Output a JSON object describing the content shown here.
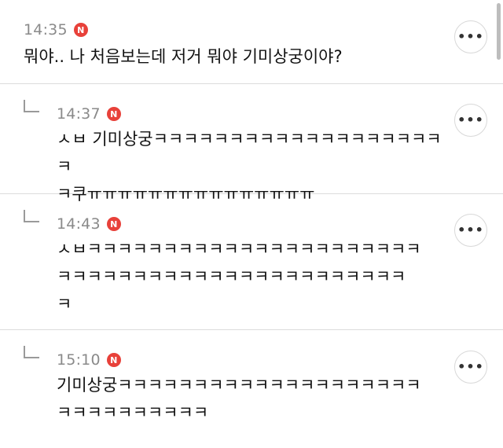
{
  "comments": [
    {
      "time": "14:35",
      "badge": "N",
      "text": "뭐야.. 나 처음보는데 저거 뭐야 기미상궁이야?",
      "more_label": "•••",
      "is_reply": false
    },
    {
      "time": "14:37",
      "badge": "N",
      "text": "ㅅㅂ 기미상궁ㅋㅋㅋㅋㅋㅋㅋㅋㅋㅋㅋㅋㅋㅋㅋㅋㅋㅋㅋㅋ\nㅋ쿠ㅠㅠㅠㅠㅠㅠㅠㅠㅠㅠㅠㅠㅠㅠㅠ",
      "more_label": "•••",
      "is_reply": true
    },
    {
      "time": "14:43",
      "badge": "N",
      "text": "ㅅㅂㅋㅋㅋㅋㅋㅋㅋㅋㅋㅋㅋㅋㅋㅋㅋㅋㅋㅋㅋㅋㅋㅋ\nㅋㅋㅋㅋㅋㅋㅋㅋㅋㅋㅋㅋㅋㅋㅋㅋㅋㅋㅋㅋㅋㅋㅋ\nㅋ",
      "more_label": "•••",
      "is_reply": true
    },
    {
      "time": "15:10",
      "badge": "N",
      "text": "기미상궁ㅋㅋㅋㅋㅋㅋㅋㅋㅋㅋㅋㅋㅋㅋㅋㅋㅋㅋㅋㅋ\nㅋㅋㅋㅋㅋㅋㅋㅋㅋㅋ",
      "more_label": "•••",
      "is_reply": true
    }
  ],
  "colors": {
    "badge": "#e8413a",
    "time": "#8a8a8a",
    "divider": "#dcdcdc",
    "text": "#111111"
  }
}
